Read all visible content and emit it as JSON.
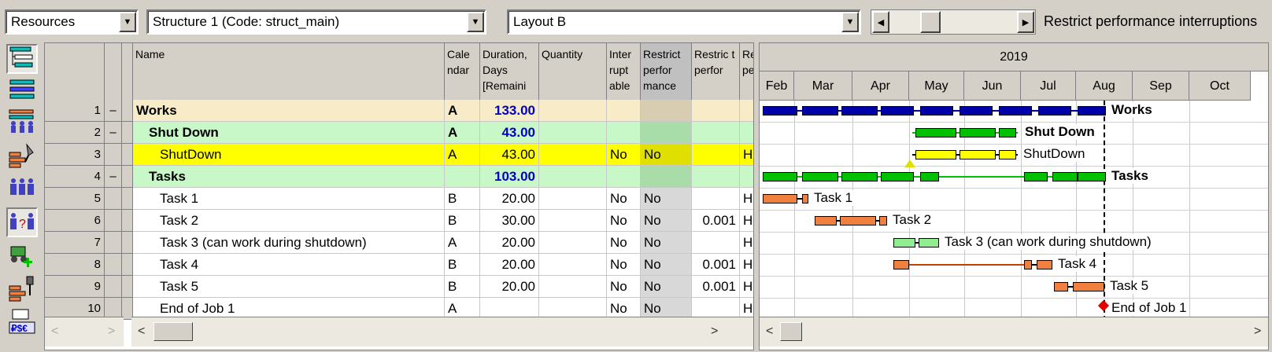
{
  "toolbar": {
    "view_select": "Resources",
    "structure_select": "Structure 1 (Code: struct_main)",
    "layout_select": "Layout B",
    "restrict_label": "Restrict performance interruptions"
  },
  "grid": {
    "headers": {
      "name": "Name",
      "calendar": "Cale ndar",
      "duration": "Duration, Days [Remaini",
      "quantity": "Quantity",
      "interruptable": "Inter rupt able",
      "restrict_performance": "Restrict perfor mance",
      "restrict_perfor_1": "Restric t perfor",
      "restrict_perfor_2": "Restri ct perfor"
    },
    "rows": [
      {
        "num": "1",
        "sep": "–",
        "name": "Works",
        "cal": "A",
        "dur": "133.00",
        "qty": "",
        "inter": "",
        "restrict": "",
        "rp1": "",
        "rp2": ""
      },
      {
        "num": "2",
        "sep": "–",
        "name": "Shut Down",
        "cal": "A",
        "dur": "43.00",
        "qty": "",
        "inter": "",
        "restrict": "",
        "rp1": "",
        "rp2": ""
      },
      {
        "num": "3",
        "sep": "",
        "name": "ShutDown",
        "cal": "A",
        "dur": "43.00",
        "qty": "",
        "inter": "No",
        "restrict": "No",
        "rp1": "",
        "rp2": "Hour"
      },
      {
        "num": "4",
        "sep": "–",
        "name": "Tasks",
        "cal": "",
        "dur": "103.00",
        "qty": "",
        "inter": "",
        "restrict": "",
        "rp1": "",
        "rp2": ""
      },
      {
        "num": "5",
        "sep": "",
        "name": "Task 1",
        "cal": "B",
        "dur": "20.00",
        "qty": "",
        "inter": "No",
        "restrict": "No",
        "rp1": "",
        "rp2": "Hour"
      },
      {
        "num": "6",
        "sep": "",
        "name": "Task 2",
        "cal": "B",
        "dur": "30.00",
        "qty": "",
        "inter": "No",
        "restrict": "No",
        "rp1": "0.001",
        "rp2": "Hour"
      },
      {
        "num": "7",
        "sep": "",
        "name": "Task 3 (can work during shutdown)",
        "cal": "A",
        "dur": "20.00",
        "qty": "",
        "inter": "No",
        "restrict": "No",
        "rp1": "",
        "rp2": "Hour"
      },
      {
        "num": "8",
        "sep": "",
        "name": "Task 4",
        "cal": "B",
        "dur": "20.00",
        "qty": "",
        "inter": "No",
        "restrict": "No",
        "rp1": "0.001",
        "rp2": "Hour"
      },
      {
        "num": "9",
        "sep": "",
        "name": "Task 5",
        "cal": "B",
        "dur": "20.00",
        "qty": "",
        "inter": "No",
        "restrict": "No",
        "rp1": "0.001",
        "rp2": "Hour"
      },
      {
        "num": "10",
        "sep": "",
        "name": "End of Job 1",
        "cal": "A",
        "dur": "",
        "qty": "",
        "inter": "No",
        "restrict": "No",
        "rp1": "",
        "rp2": "Hour"
      }
    ]
  },
  "gantt": {
    "year": "2019",
    "months": [
      "Feb",
      "Mar",
      "Apr",
      "May",
      "Jun",
      "Jul",
      "Aug",
      "Sep",
      "Oct"
    ],
    "labels": {
      "works": "Works",
      "shut_down": "Shut Down",
      "shutdown": "ShutDown",
      "tasks": "Tasks",
      "task1": "Task 1",
      "task2": "Task 2",
      "task3": "Task 3 (can work during shutdown)",
      "task4": "Task 4",
      "task5": "Task 5",
      "end": "End of Job 1"
    }
  },
  "colors": {
    "summary_blue": "#0000a8",
    "shutdown_green": "#00c000",
    "shutdown_yellow": "#ffff00",
    "task_orange": "#f08040",
    "task3_lightgreen": "#90ee90",
    "row_works_bg": "#f8ecc8",
    "row_green_bg": "#c8f8c8",
    "row_yellow_bg": "#ffff00",
    "restrict_col_bg": "#d8d8d8"
  }
}
